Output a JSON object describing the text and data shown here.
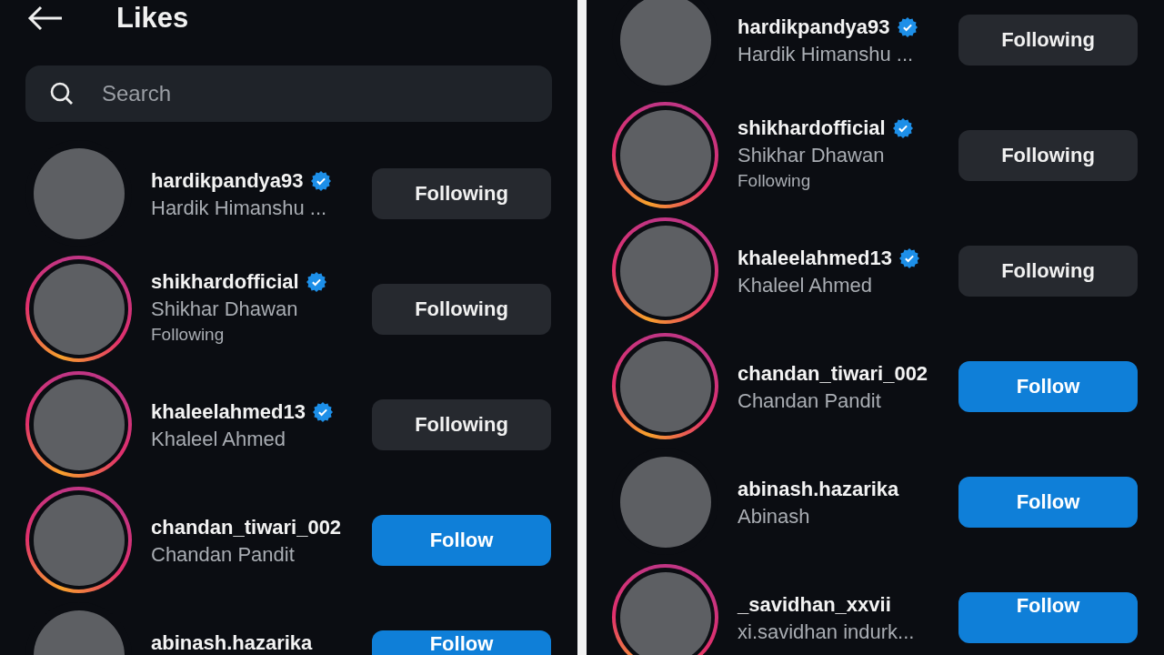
{
  "left_screen": {
    "header": {
      "title": "Likes"
    },
    "search": {
      "placeholder": "Search"
    },
    "users": [
      {
        "username": "hardikpandya93",
        "verified": true,
        "full_name": "Hardik Himanshu ...",
        "story": false,
        "button": {
          "label": "Following",
          "kind": "following"
        }
      },
      {
        "username": "shikhardofficial",
        "verified": true,
        "full_name": "Shikhar Dhawan",
        "note": "Following",
        "story": true,
        "button": {
          "label": "Following",
          "kind": "following"
        }
      },
      {
        "username": "khaleelahmed13",
        "verified": true,
        "full_name": "Khaleel Ahmed",
        "story": true,
        "button": {
          "label": "Following",
          "kind": "following"
        }
      },
      {
        "username": "chandan_tiwari_002",
        "verified": false,
        "full_name": "Chandan Pandit",
        "story": true,
        "button": {
          "label": "Follow",
          "kind": "follow"
        }
      },
      {
        "username": "abinash.hazarika",
        "verified": false,
        "story": false,
        "button": {
          "label": "Follow",
          "kind": "follow"
        }
      }
    ]
  },
  "right_screen": {
    "users": [
      {
        "username": "hardikpandya93",
        "verified": true,
        "full_name": "Hardik Himanshu ...",
        "story": false,
        "button": {
          "label": "Following",
          "kind": "following"
        }
      },
      {
        "username": "shikhardofficial",
        "verified": true,
        "full_name": "Shikhar Dhawan",
        "note": "Following",
        "story": true,
        "button": {
          "label": "Following",
          "kind": "following"
        }
      },
      {
        "username": "khaleelahmed13",
        "verified": true,
        "full_name": "Khaleel Ahmed",
        "story": true,
        "button": {
          "label": "Following",
          "kind": "following"
        }
      },
      {
        "username": "chandan_tiwari_002",
        "verified": false,
        "full_name": "Chandan Pandit",
        "story": true,
        "button": {
          "label": "Follow",
          "kind": "follow"
        }
      },
      {
        "username": "abinash.hazarika",
        "verified": false,
        "full_name": "Abinash",
        "story": false,
        "button": {
          "label": "Follow",
          "kind": "follow"
        }
      },
      {
        "username": "_savidhan_xxvii",
        "verified": false,
        "full_name": "xi.savidhan indurk...",
        "story": true,
        "button": {
          "label": "Follow",
          "kind": "follow"
        }
      }
    ]
  }
}
